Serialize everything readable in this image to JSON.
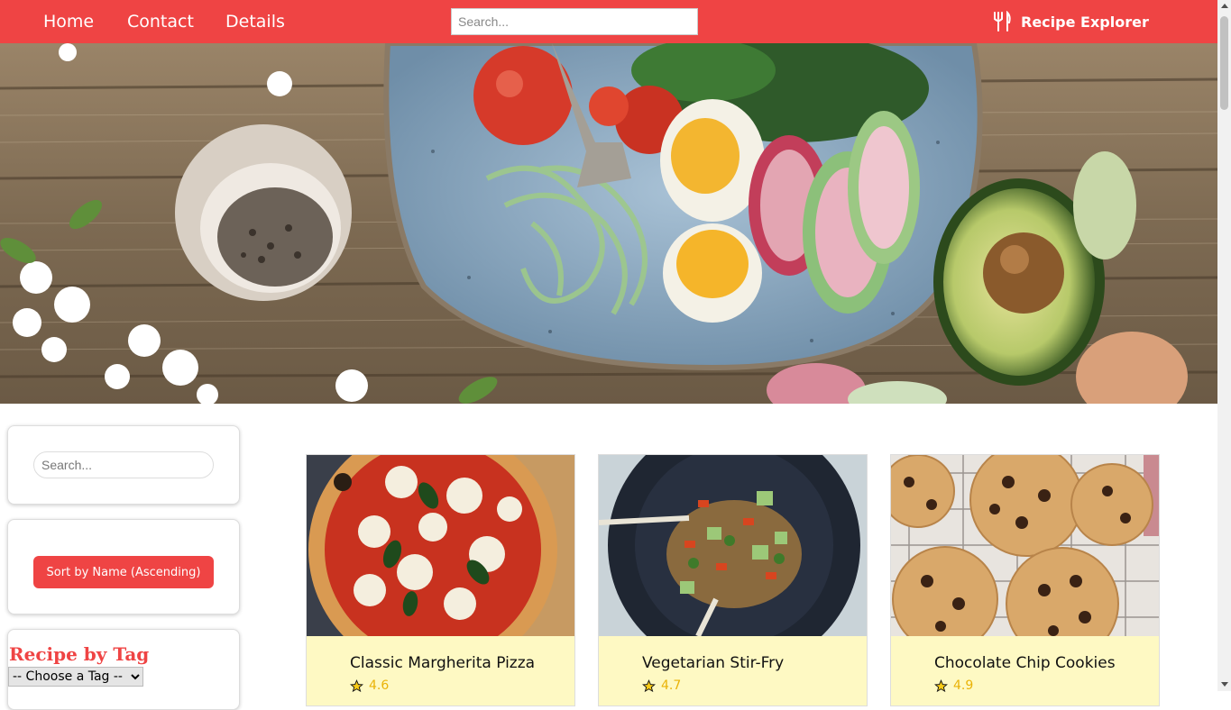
{
  "nav": {
    "links": [
      "Home",
      "Contact",
      "Details"
    ],
    "search_placeholder": "Search...",
    "brand": "Recipe Explorer",
    "brand_icon": "utensils-icon"
  },
  "colors": {
    "accent": "#ef4444",
    "card_bg": "#fef9c3",
    "rating": "#eab308"
  },
  "sidebar": {
    "search_placeholder": "Search...",
    "sort_label": "Sort by Name (Ascending)",
    "tag_title": "Recipe by Tag",
    "tag_select_value": "-- Choose a Tag --"
  },
  "recipes": [
    {
      "title": "Classic Margherita Pizza",
      "rating": "4.6"
    },
    {
      "title": "Vegetarian Stir-Fry",
      "rating": "4.7"
    },
    {
      "title": "Chocolate Chip Cookies",
      "rating": "4.9"
    }
  ]
}
